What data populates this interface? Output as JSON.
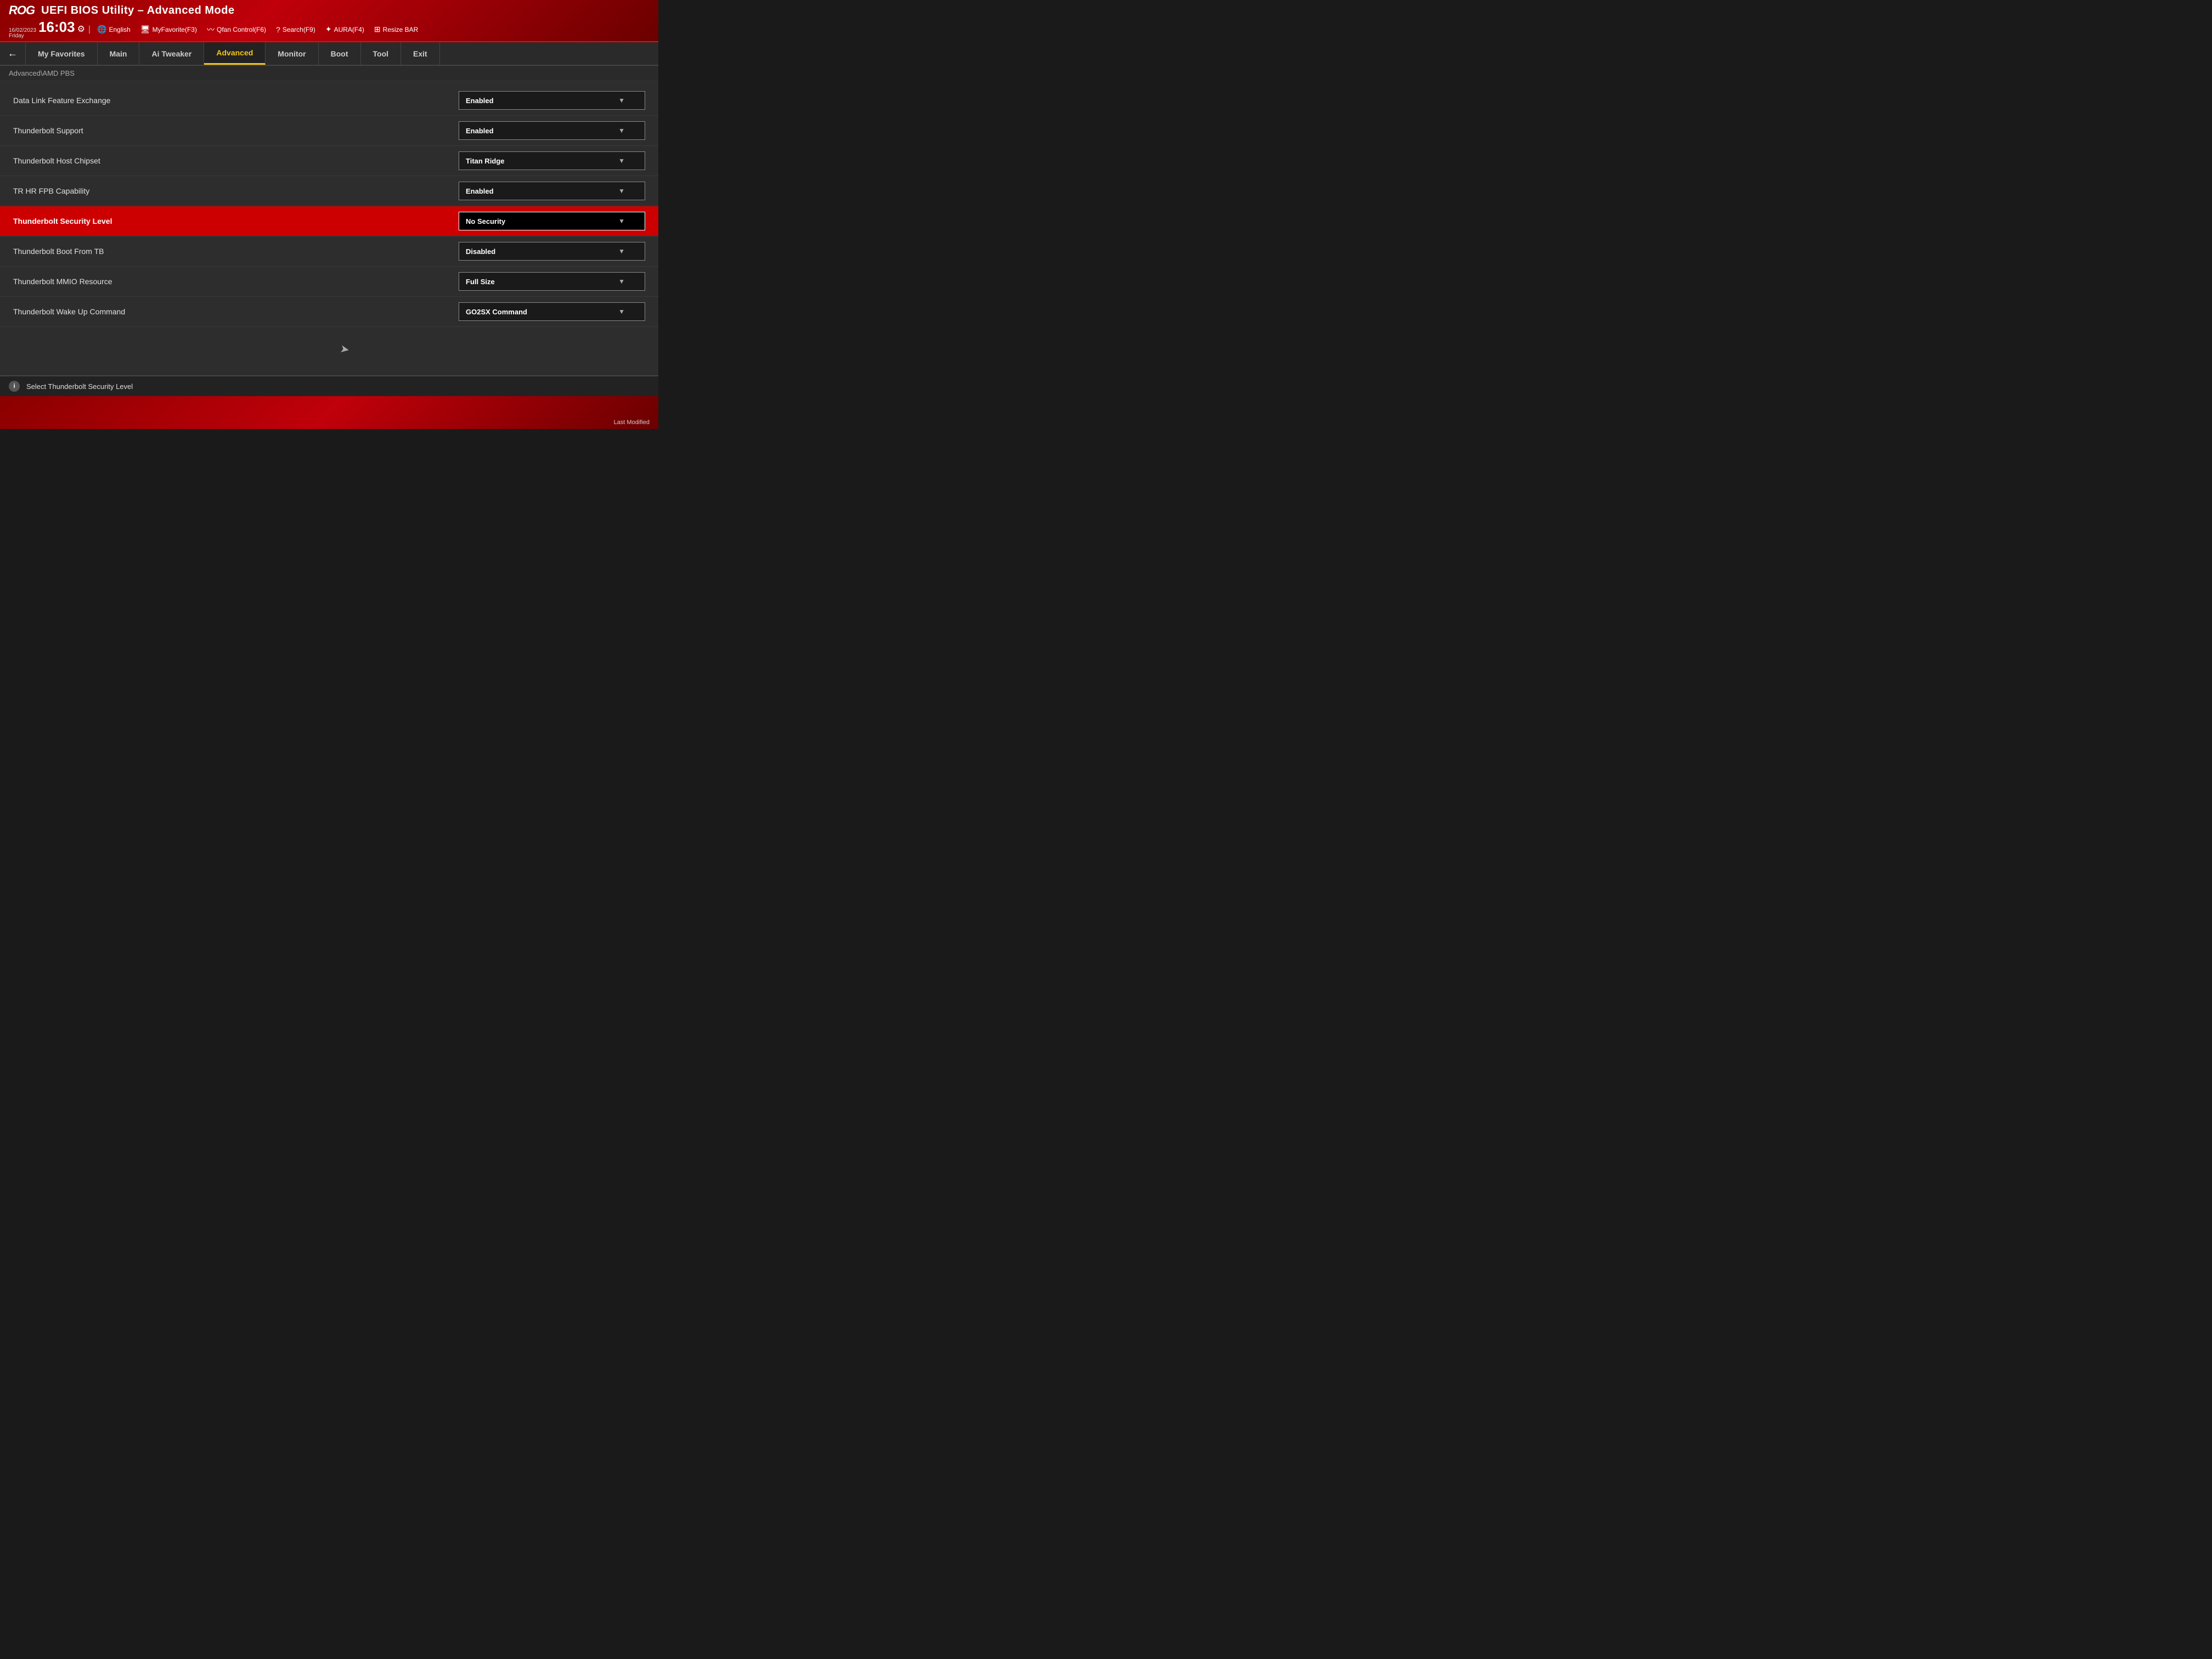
{
  "header": {
    "logo": "ROG",
    "title": "UEFI BIOS Utility – Advanced Mode",
    "date": "16/02/2023",
    "day": "Friday",
    "time": "16:03",
    "gear": "⚙",
    "divider": "|",
    "buttons": [
      {
        "id": "language",
        "icon": "🌐",
        "label": "English"
      },
      {
        "id": "myfavorite",
        "icon": "🖥",
        "label": "MyFavorite(F3)"
      },
      {
        "id": "qfan",
        "icon": "∿",
        "label": "Qfan Control(F6)"
      },
      {
        "id": "search",
        "icon": "?",
        "label": "Search(F9)"
      },
      {
        "id": "aura",
        "icon": "✦",
        "label": "AURA(F4)"
      },
      {
        "id": "resizebar",
        "icon": "⊞",
        "label": "Resize BAR"
      }
    ]
  },
  "nav": {
    "back_label": "←",
    "tabs": [
      {
        "id": "my-favorites",
        "label": "My Favorites",
        "active": false
      },
      {
        "id": "main",
        "label": "Main",
        "active": false
      },
      {
        "id": "ai-tweaker",
        "label": "Ai Tweaker",
        "active": false
      },
      {
        "id": "advanced",
        "label": "Advanced",
        "active": true
      },
      {
        "id": "monitor",
        "label": "Monitor",
        "active": false
      },
      {
        "id": "boot",
        "label": "Boot",
        "active": false
      },
      {
        "id": "tool",
        "label": "Tool",
        "active": false
      },
      {
        "id": "exit",
        "label": "Exit",
        "active": false
      }
    ]
  },
  "breadcrumb": {
    "path": "Advanced\\AMD PBS"
  },
  "settings": [
    {
      "id": "data-link-feature-exchange",
      "label": "Data Link Feature Exchange",
      "value": "Enabled",
      "selected": false
    },
    {
      "id": "thunderbolt-support",
      "label": "Thunderbolt Support",
      "value": "Enabled",
      "selected": false
    },
    {
      "id": "thunderbolt-host-chipset",
      "label": "Thunderbolt Host Chipset",
      "value": "Titan Ridge",
      "selected": false
    },
    {
      "id": "tr-hr-fpb-capability",
      "label": "TR HR FPB Capability",
      "value": "Enabled",
      "selected": false
    },
    {
      "id": "thunderbolt-security-level",
      "label": "Thunderbolt Security Level",
      "value": "No Security",
      "selected": true
    },
    {
      "id": "thunderbolt-boot-from-tb",
      "label": "Thunderbolt Boot From TB",
      "value": "Disabled",
      "selected": false
    },
    {
      "id": "thunderbolt-mmio-resource",
      "label": "Thunderbolt MMIO Resource",
      "value": "Full Size",
      "selected": false
    },
    {
      "id": "thunderbolt-wake-up-command",
      "label": "Thunderbolt Wake Up Command",
      "value": "GO2SX Command",
      "selected": false
    }
  ],
  "status_bar": {
    "info_label": "i",
    "message": "Select Thunderbolt Security Level"
  },
  "bottom": {
    "last_modified_label": "Last Modified"
  },
  "colors": {
    "active_tab": "#f5c518",
    "selected_row_bg": "#cc0000",
    "header_bg": "#c0000a",
    "nav_bg": "#2a2a2a"
  }
}
